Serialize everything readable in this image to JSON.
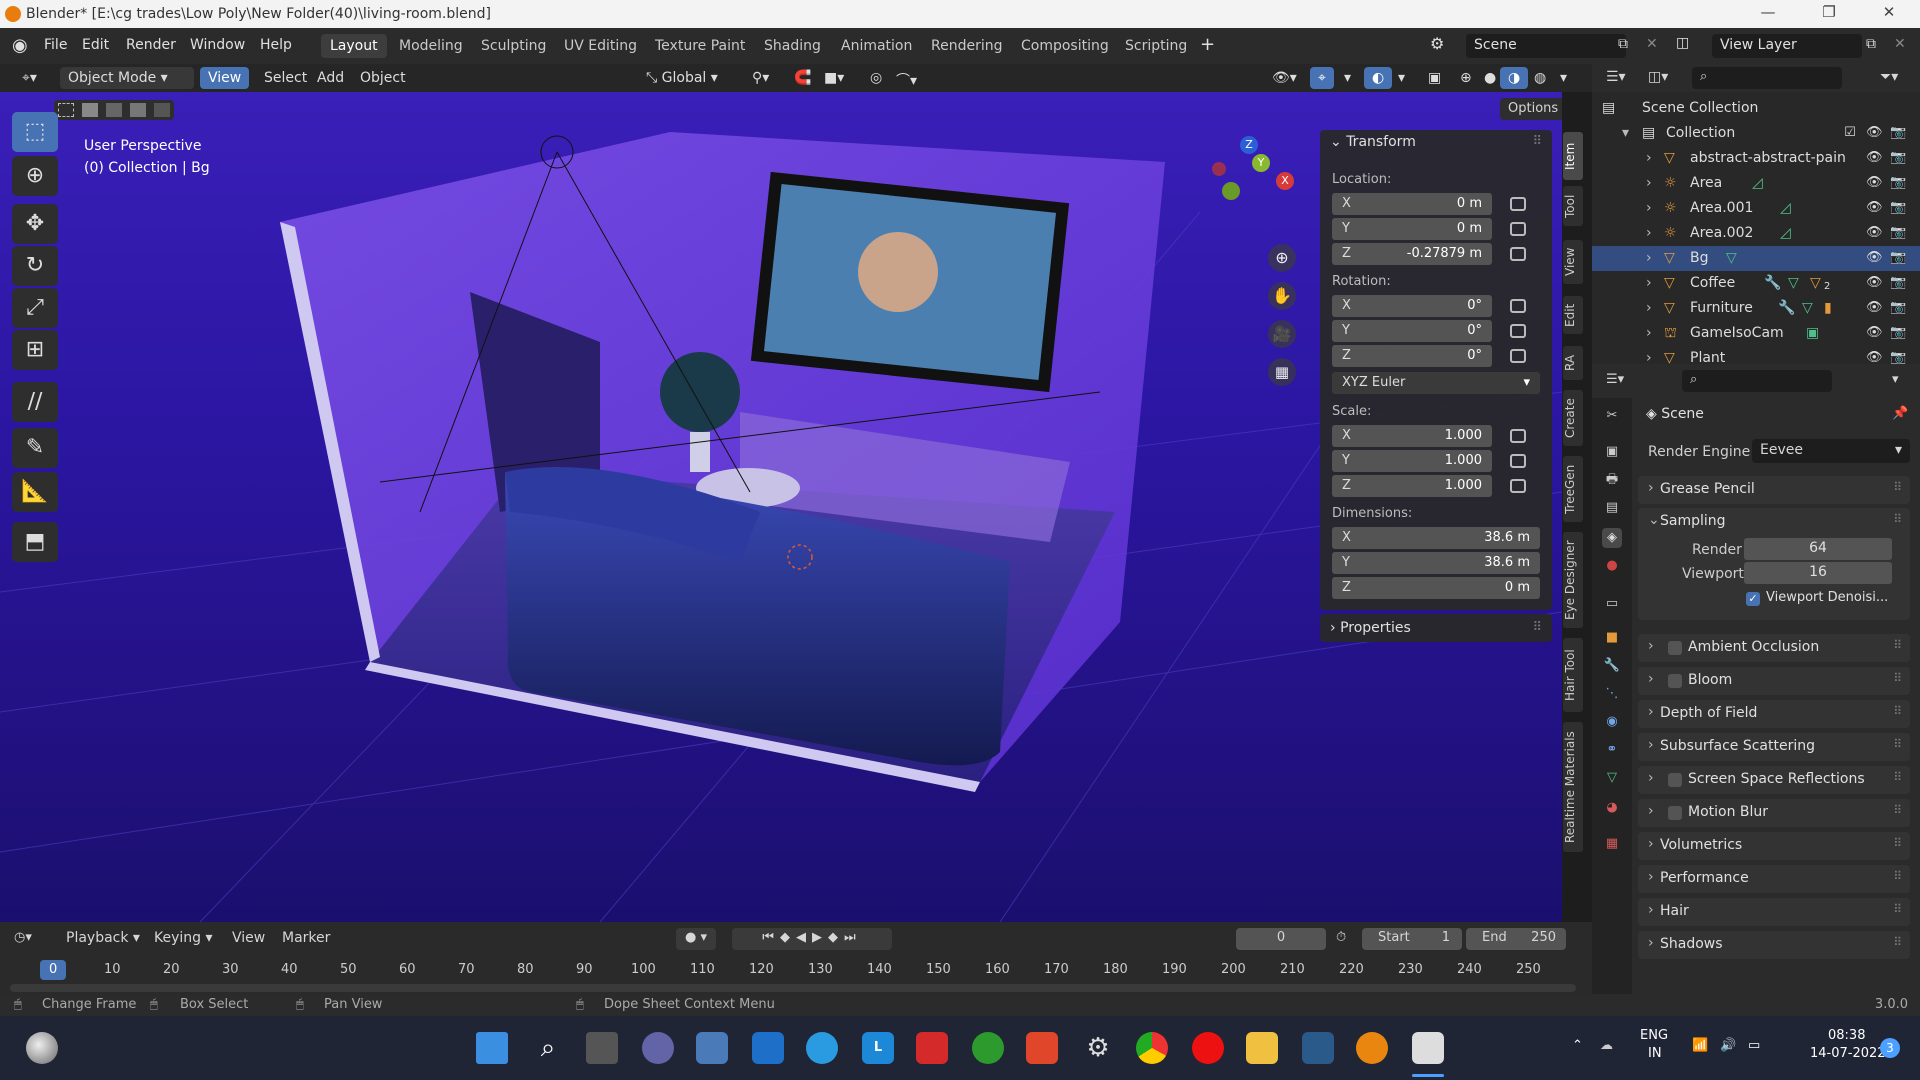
{
  "window": {
    "title": "Blender* [E:\\cg trades\\Low Poly\\New Folder(40)\\living-room.blend]"
  },
  "menu": [
    "File",
    "Edit",
    "Render",
    "Window",
    "Help"
  ],
  "workspaces": [
    "Layout",
    "Modeling",
    "Sculpting",
    "UV Editing",
    "Texture Paint",
    "Shading",
    "Animation",
    "Rendering",
    "Compositing",
    "Scripting"
  ],
  "scene_field": "Scene",
  "view_layer_field": "View Layer",
  "header": {
    "mode": "Object Mode",
    "view": "View",
    "select": "Select",
    "add": "Add",
    "object": "Object",
    "orientation": "Global",
    "options": "Options"
  },
  "viewport": {
    "perspective": "User Perspective",
    "collection": "(0) Collection | Bg"
  },
  "npanel": {
    "transform": "Transform",
    "location_label": "Location:",
    "location": [
      {
        "ax": "X",
        "v": "0 m"
      },
      {
        "ax": "Y",
        "v": "0 m"
      },
      {
        "ax": "Z",
        "v": "-0.27879 m"
      }
    ],
    "rotation_label": "Rotation:",
    "rotation": [
      {
        "ax": "X",
        "v": "0°"
      },
      {
        "ax": "Y",
        "v": "0°"
      },
      {
        "ax": "Z",
        "v": "0°"
      }
    ],
    "rotation_mode": "XYZ Euler",
    "scale_label": "Scale:",
    "scale": [
      {
        "ax": "X",
        "v": "1.000"
      },
      {
        "ax": "Y",
        "v": "1.000"
      },
      {
        "ax": "Z",
        "v": "1.000"
      }
    ],
    "dimensions_label": "Dimensions:",
    "dimensions": [
      {
        "ax": "X",
        "v": "38.6 m"
      },
      {
        "ax": "Y",
        "v": "38.6 m"
      },
      {
        "ax": "Z",
        "v": "0 m"
      }
    ],
    "properties": "Properties"
  },
  "vtabs": [
    "Item",
    "Tool",
    "View",
    "Edit",
    "RA",
    "Create",
    "TreeGen",
    "Eye Designer",
    "Hair Tool",
    "Realtime Materials"
  ],
  "outliner": {
    "scene_collection": "Scene Collection",
    "collection": "Collection",
    "items": [
      "abstract-abstract-pain",
      "Area",
      "Area.001",
      "Area.002",
      "Bg",
      "Coffee",
      "Furniture",
      "GameIsoCam",
      "Plant"
    ],
    "coffee_badge": "2"
  },
  "props": {
    "title": "Scene",
    "render_engine_label": "Render Engine",
    "render_engine": "Eevee",
    "grease_pencil": "Grease Pencil",
    "sampling": "Sampling",
    "render_label": "Render",
    "render_value": "64",
    "viewport_label": "Viewport",
    "viewport_value": "16",
    "viewport_denoise": "Viewport Denoisi...",
    "sections": [
      "Ambient Occlusion",
      "Bloom",
      "Depth of Field",
      "Subsurface Scattering",
      "Screen Space Reflections",
      "Motion Blur",
      "Volumetrics",
      "Performance",
      "Hair",
      "Shadows"
    ]
  },
  "timeline": {
    "playback": "Playback",
    "keying": "Keying",
    "view": "View",
    "marker": "Marker",
    "current_frame": "0",
    "start_label": "Start",
    "start": "1",
    "end_label": "End",
    "end": "250",
    "ticks": [
      "0",
      "10",
      "20",
      "30",
      "40",
      "50",
      "60",
      "70",
      "80",
      "90",
      "100",
      "110",
      "120",
      "130",
      "140",
      "150",
      "160",
      "170",
      "180",
      "190",
      "200",
      "210",
      "220",
      "230",
      "240",
      "250"
    ]
  },
  "status": {
    "change_frame": "Change Frame",
    "box_select": "Box Select",
    "pan_view": "Pan View",
    "context_menu": "Dope Sheet Context Menu",
    "version": "3.0.0"
  },
  "taskbar": {
    "lang1": "ENG",
    "lang2": "IN",
    "time": "08:38",
    "date": "14-07-2022",
    "notif": "3"
  }
}
